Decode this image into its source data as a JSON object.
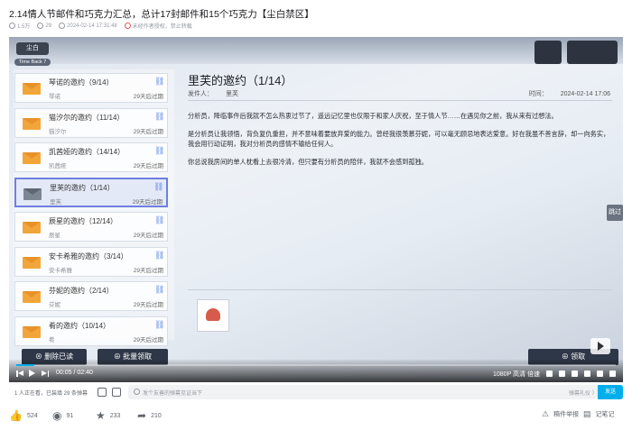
{
  "video": {
    "title": "2.14情人节邮件和巧克力汇总，总计17封邮件和15个巧克力【尘白禁区】",
    "meta": {
      "views": "1.5万",
      "danmaku": "29",
      "datetime": "2024-02-14 17:31:48",
      "notice": "未经作者授权，禁止转载"
    }
  },
  "game": {
    "top_left_badge": "尘白",
    "time_back_label": "Time Back 7",
    "mails": [
      {
        "title": "琴诺的邀约（9/14）",
        "sender": "琴诺",
        "expiry": "29天后过期",
        "selected": false
      },
      {
        "title": "猫汐尔的邀约（11/14）",
        "sender": "猫汐尔",
        "expiry": "29天后过期",
        "selected": false
      },
      {
        "title": "凯茜娅的邀约（14/14）",
        "sender": "凯茜娅",
        "expiry": "29天后过期",
        "selected": false
      },
      {
        "title": "里芙的邀约（1/14）",
        "sender": "里芙",
        "expiry": "29天后过期",
        "selected": true
      },
      {
        "title": "辰星的邀约（12/14）",
        "sender": "辰星",
        "expiry": "29天后过期",
        "selected": false
      },
      {
        "title": "安卡希雅的邀约（3/14）",
        "sender": "安卡希雅",
        "expiry": "29天后过期",
        "selected": false
      },
      {
        "title": "芬妮的邀约（2/14）",
        "sender": "芬妮",
        "expiry": "29天后过期",
        "selected": false
      },
      {
        "title": "肴的邀约（10/14）",
        "sender": "肴",
        "expiry": "29天后过期",
        "selected": false
      }
    ],
    "detail": {
      "title": "里芙的邀约（1/14）",
      "sender_label": "发件人：",
      "sender": "里芙",
      "time_label": "时间：",
      "time": "2024-02-14 17:06",
      "paragraphs": [
        "分析员，降临事件后我就不怎么热衷过节了，遥远记忆里也仅限于和家人庆祝，至于情人节……在遇见你之前，我从来有过想法。",
        "是分析员让我领悟，背负复仇重担，并不意味着要放弃爱的能力。曾经我很羡慕芬妮，可以毫无顾忌地表达爱意。好在我虽不善言辞，却一向务实，我会用行动证明，我对分析员的感情不输给任何人。",
        "你总说我房间的单人枕看上去很冷清，但只要有分析员的陪伴，我就不会感到孤独。"
      ]
    },
    "hint_label": "跳过",
    "delete_read_label": "删除已读",
    "batch_claim_label": "批量领取",
    "claim_label": "领取"
  },
  "player": {
    "current_time": "00:05",
    "duration": "02:40",
    "progress_fraction": 0.03,
    "quality_label": "1080P 高清",
    "speed_label": "倍速"
  },
  "danmaku_bar": {
    "viewers_text": "1 人正在看，已装填 29 条弹幕",
    "placeholder": "发个友善的弹幕见证当下",
    "etiquette_label": "弹幕礼仪 〉",
    "send_label": "发送"
  },
  "toolbar": {
    "like_count": "524",
    "coin_count": "91",
    "favorite_count": "233",
    "share_count": "210",
    "report_label": "稿件举报",
    "notes_label": "记笔记"
  },
  "colors": {
    "accent": "#00aeec",
    "selected_border": "#6f7fe0",
    "envelope": "#f2a63a"
  }
}
